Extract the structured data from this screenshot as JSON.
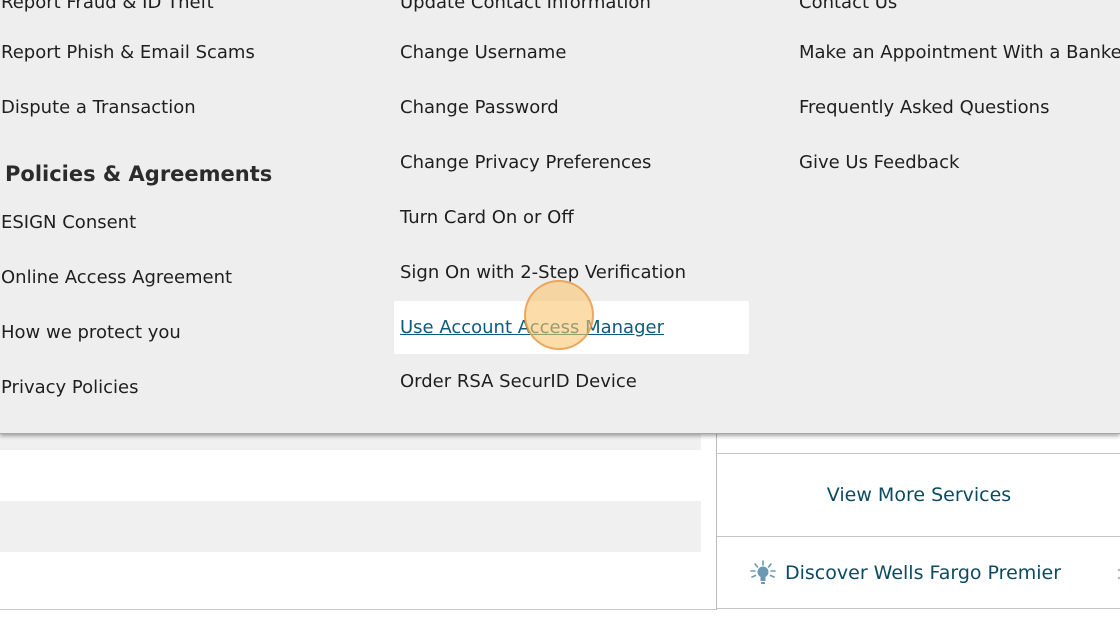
{
  "menu": {
    "columns": [
      {
        "items": [
          "Report Fraud & ID Theft",
          "Report Phish & Email Scams",
          "Dispute a Transaction"
        ],
        "section": {
          "heading": "Policies & Agreements",
          "items": [
            "ESIGN Consent",
            "Online Access Agreement",
            "How we protect you",
            "Privacy Policies"
          ]
        }
      },
      {
        "items": [
          "Update Contact Information",
          "Change Username",
          "Change Password",
          "Change Privacy Preferences",
          "Turn Card On or Off",
          "Sign On with 2-Step Verification",
          "Use Account Access Manager",
          "Order RSA SecurID Device"
        ],
        "active_item": "Use Account Access Manager"
      },
      {
        "items": [
          "Contact Us",
          "Make an Appointment With a Banker",
          "Frequently Asked Questions",
          "Give Us Feedback"
        ]
      }
    ]
  },
  "right_panel": {
    "view_more": "View More Services",
    "discover": "Discover Wells Fargo Premier",
    "discover_icon": "lightbulb-icon"
  },
  "colors": {
    "menu_bg": "#eeeeee",
    "link": "#0c4a61",
    "active_link": "#0c5a7c",
    "click_marker": "#fac46e"
  }
}
